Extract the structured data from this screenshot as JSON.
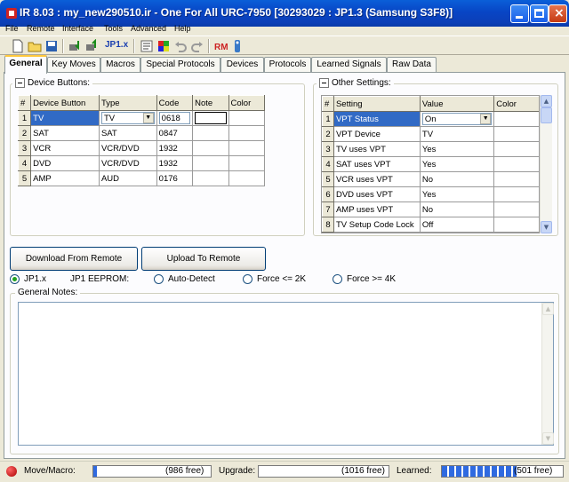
{
  "window": {
    "title": "IR 8.03 : my_new290510.ir - One For All URC-7950 [30293029 : JP1.3 (Samsung S3F8)]"
  },
  "menu": [
    "File",
    "Remote",
    "Interface",
    "Tools",
    "Advanced",
    "Help"
  ],
  "toolbar": {
    "jp1_label": "JP1.x"
  },
  "tabs": [
    "General",
    "Key Moves",
    "Macros",
    "Special Protocols",
    "Devices",
    "Protocols",
    "Learned Signals",
    "Raw Data"
  ],
  "device_buttons": {
    "title": "Device Buttons:",
    "columns": [
      "#",
      "Device Button",
      "Type",
      "Code",
      "Note",
      "Color"
    ],
    "rows": [
      {
        "n": "1",
        "button": "TV",
        "type": "TV",
        "code": "0618"
      },
      {
        "n": "2",
        "button": "SAT",
        "type": "SAT",
        "code": "0847"
      },
      {
        "n": "3",
        "button": "VCR",
        "type": "VCR/DVD",
        "code": "1932"
      },
      {
        "n": "4",
        "button": "DVD",
        "type": "VCR/DVD",
        "code": "1932"
      },
      {
        "n": "5",
        "button": "AMP",
        "type": "AUD",
        "code": "0176"
      }
    ]
  },
  "other_settings": {
    "title": "Other Settings:",
    "columns": [
      "#",
      "Setting",
      "Value",
      "Color"
    ],
    "rows": [
      {
        "n": "1",
        "setting": "VPT Status",
        "value": "On"
      },
      {
        "n": "2",
        "setting": "VPT Device",
        "value": "TV"
      },
      {
        "n": "3",
        "setting": "TV  uses VPT",
        "value": "Yes"
      },
      {
        "n": "4",
        "setting": "SAT uses VPT",
        "value": "Yes"
      },
      {
        "n": "5",
        "setting": "VCR uses VPT",
        "value": "No"
      },
      {
        "n": "6",
        "setting": "DVD uses VPT",
        "value": "Yes"
      },
      {
        "n": "7",
        "setting": "AMP uses VPT",
        "value": "No"
      },
      {
        "n": "8",
        "setting": "TV Setup Code Lock",
        "value": "Off"
      }
    ]
  },
  "buttons": {
    "download": "Download From Remote",
    "upload": "Upload To Remote"
  },
  "interface_options": {
    "jp1x": "JP1.x",
    "eeprom_label": "JP1 EEPROM:",
    "auto_detect": "Auto-Detect",
    "force_2k": "Force <= 2K",
    "force_4k": "Force >= 4K",
    "selected": "JP1.x"
  },
  "notes": {
    "label": "General Notes:",
    "value": ""
  },
  "status": {
    "move_macro_label": "Move/Macro:",
    "move_macro_free": "(986 free)",
    "move_macro_fill": 0.03,
    "upgrade_label": "Upgrade:",
    "upgrade_free": "(1016 free)",
    "upgrade_fill": 0,
    "learned_label": "Learned:",
    "learned_free": "(501 free)",
    "learned_fill": 0.62
  },
  "colors": {
    "titlebar": "#0845c5",
    "selection": "#316ac5",
    "tab_active_accent": "#ffc83c"
  }
}
